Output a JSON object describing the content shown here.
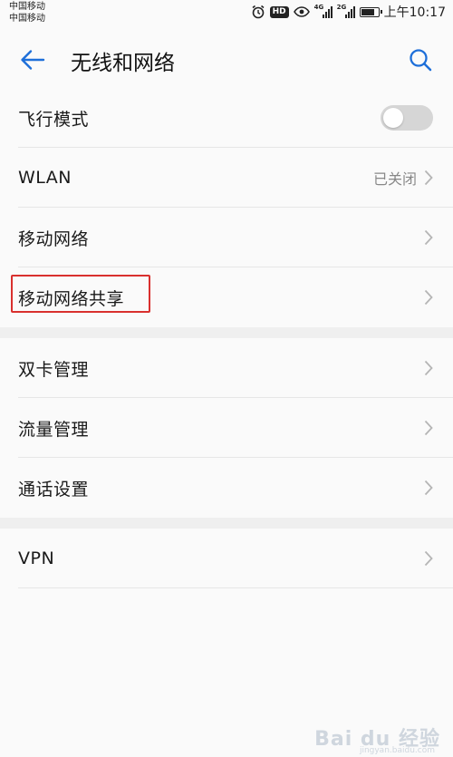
{
  "status_bar": {
    "carrier_1": "中国移动",
    "carrier_2": "中国移动",
    "network_1": "4G",
    "network_2": "2G",
    "hd_badge": "HD",
    "time": "上午10:17"
  },
  "header": {
    "title": "无线和网络"
  },
  "airplane": {
    "label": "飞行模式",
    "enabled": false
  },
  "wlan": {
    "label": "WLAN",
    "value": "已关闭"
  },
  "mobile_network": {
    "label": "移动网络"
  },
  "tethering": {
    "label": "移动网络共享"
  },
  "dual_sim": {
    "label": "双卡管理"
  },
  "data_usage": {
    "label": "流量管理"
  },
  "call_settings": {
    "label": "通话设置"
  },
  "vpn": {
    "label": "VPN"
  },
  "watermark": {
    "text": "Bai du 经验",
    "sub": "jingyan.baidu.com"
  },
  "colors": {
    "accent": "#1e6fd9",
    "highlight": "#d9302e"
  }
}
